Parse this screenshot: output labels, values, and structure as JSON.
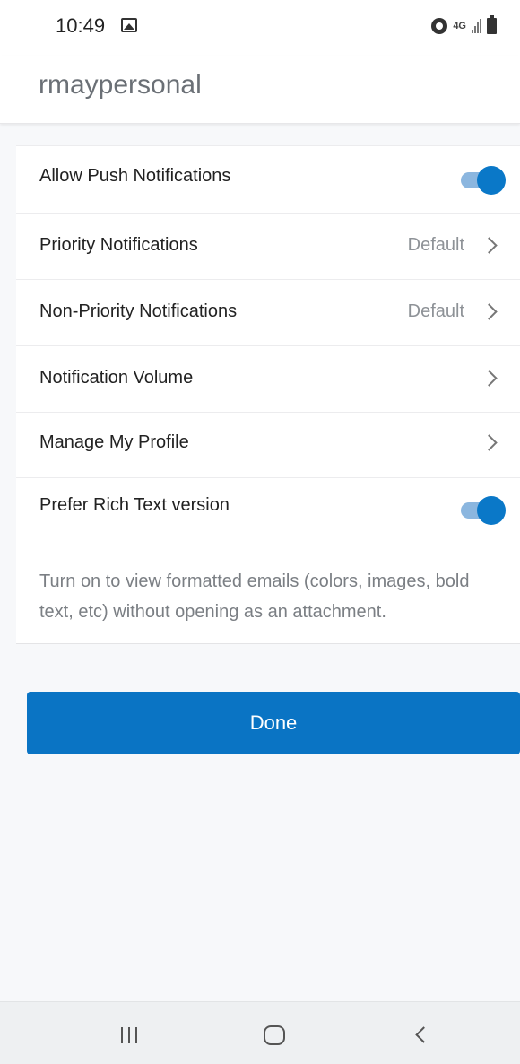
{
  "status_bar": {
    "time": "10:49",
    "network_label": "4G",
    "image_icon": "image-icon",
    "alarm_icon": "alarm-icon",
    "signal_icon": "signal-icon",
    "battery_icon": "battery-icon"
  },
  "header": {
    "title": "rmaypersonal"
  },
  "settings": {
    "rows": [
      {
        "label": "Allow Push Notifications",
        "control": "toggle",
        "on": true
      },
      {
        "label": "Priority Notifications",
        "value": "Default",
        "control": "chevron"
      },
      {
        "label": "Non-Priority Notifications",
        "value": "Default",
        "control": "chevron"
      },
      {
        "label": "Notification Volume",
        "control": "chevron"
      },
      {
        "label": "Manage My Profile",
        "control": "chevron"
      },
      {
        "label": "Prefer Rich Text version",
        "control": "toggle",
        "on": true
      }
    ],
    "rich_text_note": "Turn on to view formatted emails (colors, images, bold text, etc) without opening as an attachment."
  },
  "done_button": {
    "label": "Done"
  },
  "colors": {
    "accent": "#0a74c4",
    "toggle_knob": "#0a78c8",
    "toggle_track": "#8bb6df",
    "background": "#f7f8fa"
  },
  "nav_bar": {
    "recents_icon": "recents-icon",
    "home_icon": "home-icon",
    "back_icon": "back-icon"
  }
}
